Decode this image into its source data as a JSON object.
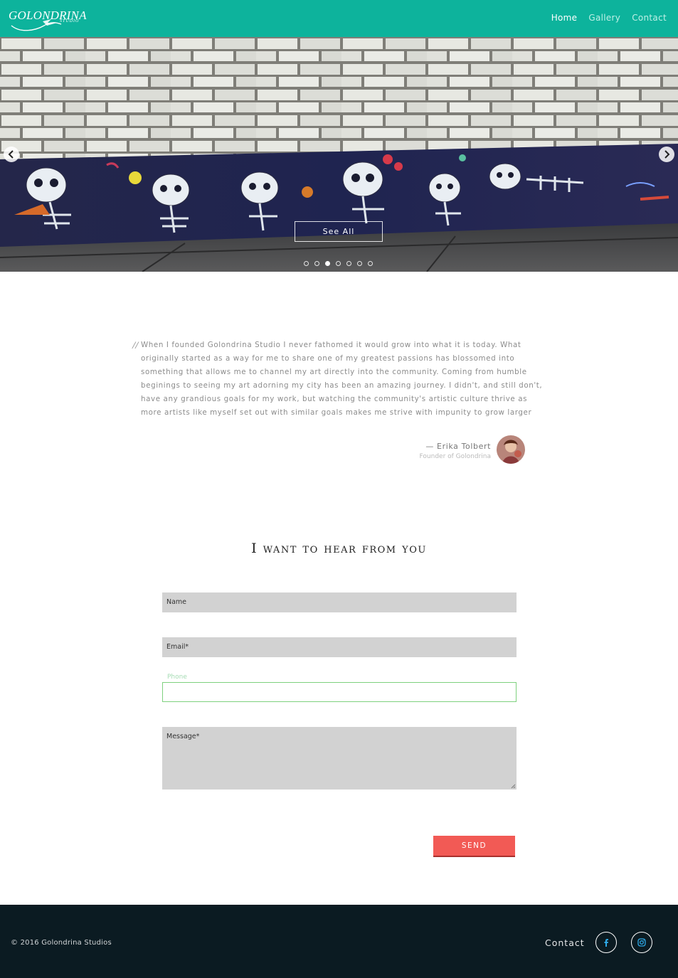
{
  "header": {
    "logo_text": "GOLONDRINA",
    "logo_subtext": "STUDIO",
    "nav": [
      {
        "label": "Home",
        "active": true
      },
      {
        "label": "Gallery",
        "active": false
      },
      {
        "label": "Contact",
        "active": false
      }
    ],
    "brand_color": "#0db39c"
  },
  "hero": {
    "see_all_label": "See All",
    "slide_count": 7,
    "active_slide": 3,
    "prev_icon": "chevron-left-icon",
    "next_icon": "chevron-right-icon"
  },
  "testimonial": {
    "quote_mark": "//",
    "text": "When I founded Golondrina Studio I never fathomed it would grow into what it is today. What originally started as a way for me to share one of my greatest passions has blossomed into something that allows me to channel my art directly into the community. Coming from humble beginings to seeing my art adorning my city has been an amazing journey. I didn't, and still don't, have any grandious goals for my work, but watching the community's artistic culture thrive as more artists like myself set out with similar goals makes me strive with impunity to grow larger",
    "author": "— Erika Tolbert",
    "role": "Founder of Golondrina"
  },
  "contact_form": {
    "title": "I want to hear from you",
    "name_placeholder": "Name",
    "email_placeholder": "Email*",
    "phone_label": "Phone",
    "message_placeholder": "Message*",
    "send_label": "SEND",
    "send_color": "#f25a55"
  },
  "footer": {
    "copyright": "© 2016 Golondrina Studios",
    "contact_label": "Contact",
    "social": [
      "facebook-icon",
      "instagram-icon"
    ]
  }
}
